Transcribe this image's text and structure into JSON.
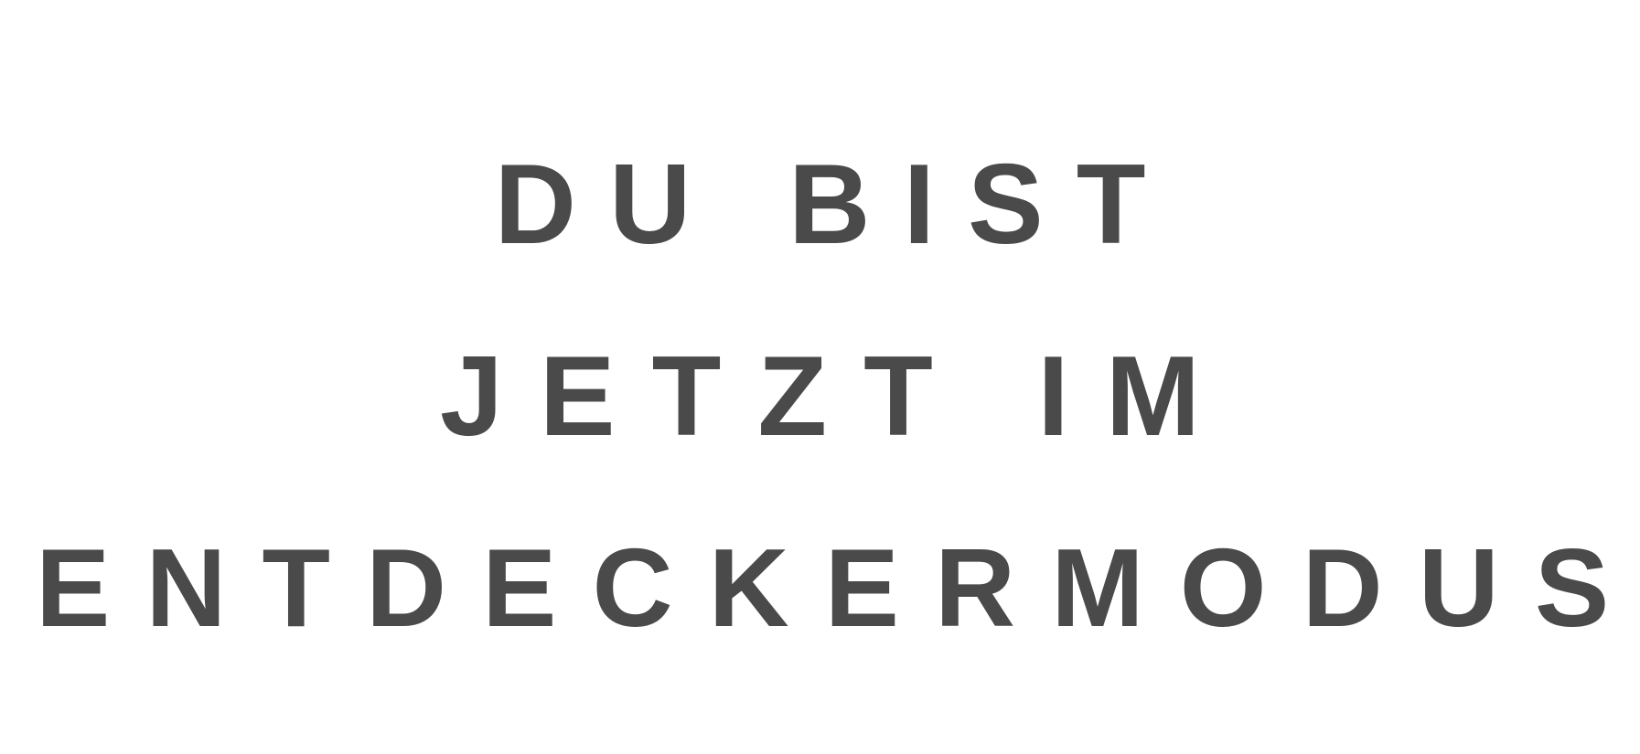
{
  "headline": {
    "line1": "DU BIST",
    "line2": "JETZT IM",
    "line3": "ENTDECKERMODUS"
  },
  "colors": {
    "text": "#4a4a4a",
    "background": "#ffffff"
  }
}
